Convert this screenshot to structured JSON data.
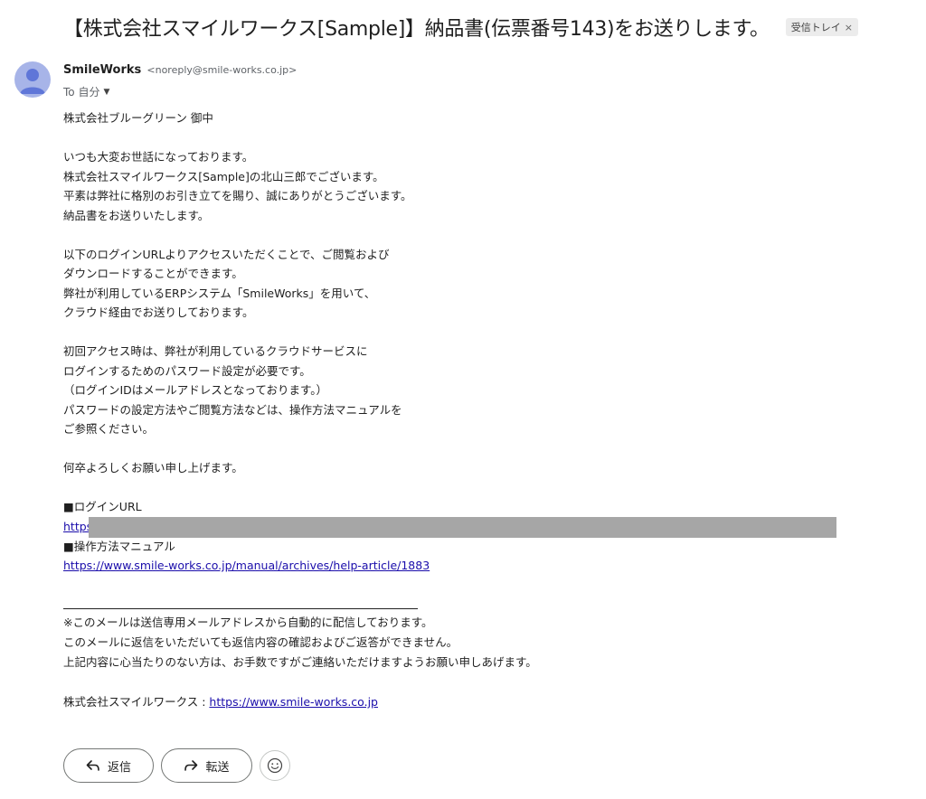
{
  "email": {
    "subject": "【株式会社スマイルワークス[Sample]】納品書(伝票番号143)をお送りします。",
    "label": "受信トレイ",
    "label_remove": "×",
    "sender_name": "SmileWorks",
    "sender_email": "<noreply@smile-works.co.jp>",
    "to": "To 自分",
    "body": {
      "greeting": "株式会社ブルーグリーン 御中",
      "para1": [
        "いつも大変お世話になっております。",
        "株式会社スマイルワークス[Sample]の北山三郎でございます。",
        "平素は弊社に格別のお引き立てを賜り、誠にありがとうございます。",
        "納品書をお送りいたします。"
      ],
      "para2": [
        "以下のログインURLよりアクセスいただくことで、ご閲覧および",
        "ダウンロードすることができます。",
        "弊社が利用しているERPシステム「SmileWorks」を用いて、",
        "クラウド経由でお送りしております。"
      ],
      "para3": [
        "初回アクセス時は、弊社が利用しているクラウドサービスに",
        "ログインするためのパスワード設定が必要です。",
        "（ログインIDはメールアドレスとなっております。）",
        "パスワードの設定方法やご閲覧方法などは、操作方法マニュアルを",
        "ご参照ください。"
      ],
      "closing": "何卒よろしくお願い申し上げます。",
      "login_heading": "■ログインURL",
      "login_url_visible": "https",
      "manual_heading": "■操作方法マニュアル",
      "manual_url": "https://www.smile-works.co.jp/manual/archives/help-article/1883"
    },
    "footer": {
      "lines": [
        "※このメールは送信専用メールアドレスから自動的に配信しております。",
        "このメールに返信をいただいても返信内容の確認およびご返答ができません。",
        "上記内容に心当たりのない方は、お手数ですがご連絡いただけますようお願い申しあげます。"
      ],
      "company_label": "株式会社スマイルワークス : ",
      "company_url": "https://www.smile-works.co.jp"
    },
    "actions": {
      "reply": "返信",
      "forward": "転送"
    }
  },
  "colors": {
    "link": "#1a0dab",
    "avatar": "#a7b4e8",
    "redaction": "#a6a6a6"
  }
}
